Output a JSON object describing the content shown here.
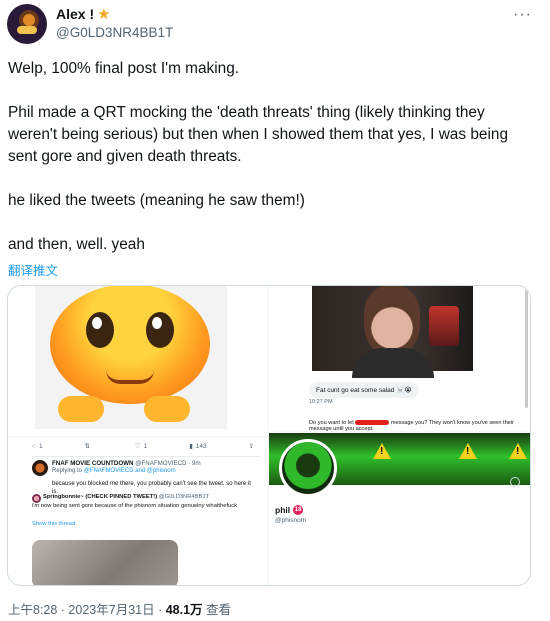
{
  "author": {
    "display_name": "Alex !",
    "badge_icon": "star-icon",
    "handle": "@G0LD3NR4BB1T"
  },
  "tweet": {
    "text": "Welp, 100% final post I'm making.\n\nPhil made a QRT mocking the 'death threats' thing (likely thinking they weren't being serious) but then when I showed them that yes, I was being sent gore and given death threats.\n\nhe liked the tweets (meaning he saw them!)\n\nand then, well. yeah",
    "translate_label": "翻译推文"
  },
  "media": {
    "dm": {
      "message": "Fat cunt go eat some salad ☠️😭",
      "time": "10:27 PM",
      "bottom_text_before": "Do you want to let",
      "bottom_text_after": "message you? They won't know you've seen their message until you accept."
    },
    "tweet_actions": {
      "replies": "1",
      "retweets": "",
      "likes": "1",
      "views": "143"
    },
    "reply": {
      "name": "FNAF MOVIE COUNTDOWN",
      "handle_time": "@FNAFMOVIECD · 9m",
      "replying_label": "Replying to",
      "replying_to": "@FNAFMOVIECD and @phisnom",
      "body": "because you blocked me there, you probably can't see the tweet. so here it is."
    },
    "quote": {
      "name": "Springbonnie~ (CHECK PINNED TWEET!)",
      "handle": "@G0LD3NR4BB1T",
      "body": "i'm now being sent gore because of the phisnom situation genuelny whatthefuck",
      "show_thread": "Show this thread"
    },
    "profile": {
      "name": "phil",
      "age_badge": "18",
      "handle": "@phisnom"
    }
  },
  "meta": {
    "time": "上午8:28 · 2023年7月31日",
    "separator": " · ",
    "views_count": "48.1万",
    "views_label": " 查看"
  },
  "colors": {
    "link": "#1d9bf0",
    "secondary_text": "#536471",
    "border": "#cfd9de"
  }
}
